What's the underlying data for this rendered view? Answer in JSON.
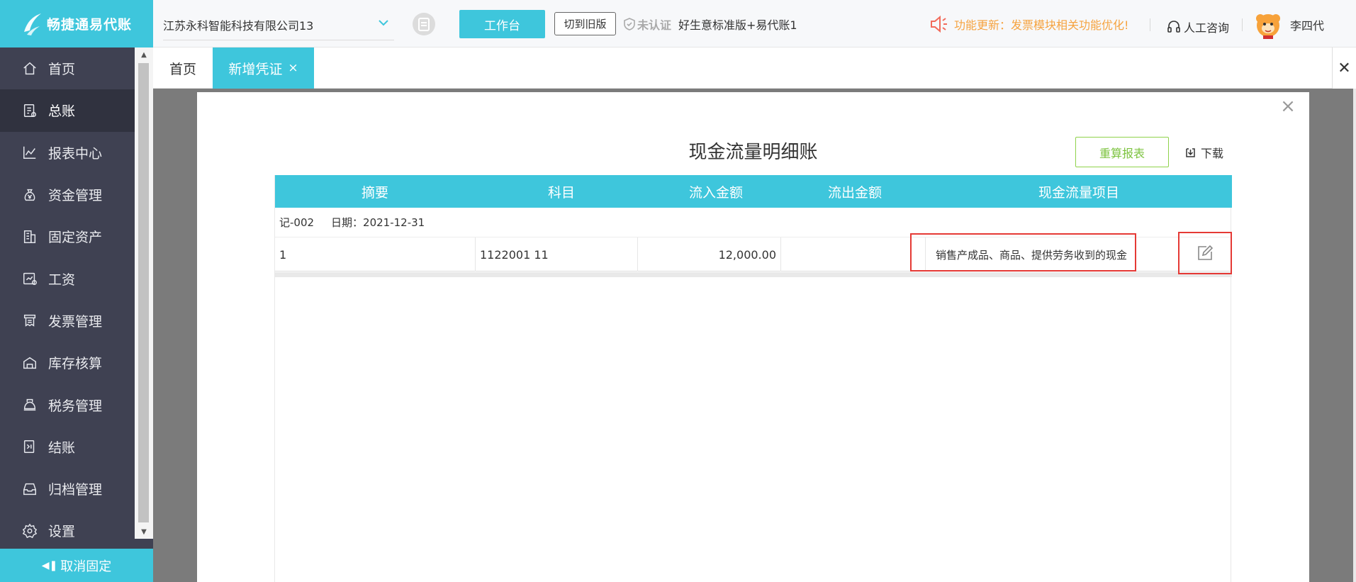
{
  "app": {
    "name": "畅捷通易代账"
  },
  "sidebar": {
    "items": [
      {
        "label": "首页",
        "icon": "home-icon"
      },
      {
        "label": "总账",
        "icon": "ledger-icon"
      },
      {
        "label": "报表中心",
        "icon": "chart-icon"
      },
      {
        "label": "资金管理",
        "icon": "money-bag-icon"
      },
      {
        "label": "固定资产",
        "icon": "building-icon"
      },
      {
        "label": "工资",
        "icon": "payroll-icon"
      },
      {
        "label": "发票管理",
        "icon": "invoice-icon"
      },
      {
        "label": "库存核算",
        "icon": "warehouse-icon"
      },
      {
        "label": "税务管理",
        "icon": "tax-icon"
      },
      {
        "label": "结账",
        "icon": "checkout-icon"
      },
      {
        "label": "归档管理",
        "icon": "archive-icon"
      },
      {
        "label": "设置",
        "icon": "gear-icon"
      }
    ],
    "active_index": 1,
    "unpin_label": "取消固定"
  },
  "topbar": {
    "company": "江苏永科智能科技有限公司13",
    "workbench_label": "工作台",
    "switch_old_label": "切到旧版",
    "cert_status": "未认证",
    "edition": "好生意标准版+易代账1",
    "notice": "功能更新：发票模块相关功能优化!",
    "consult_label": "人工咨询",
    "user_name": "李四代"
  },
  "tabs": [
    {
      "label": "首页"
    },
    {
      "label": "新增凭证",
      "close": "×"
    }
  ],
  "modal": {
    "title": "现金流量明细账",
    "recalc_label": "重算报表",
    "download_label": "下载",
    "close": "×",
    "table": {
      "headers": [
        "摘要",
        "科目",
        "流入金额",
        "流出金额",
        "现金流量项目"
      ],
      "group": {
        "voucher_no": "记-002",
        "date_label": "日期：2021-12-31"
      },
      "rows": [
        {
          "summary": "1",
          "account": "1122001 11",
          "inflow": "12,000.00",
          "outflow": "",
          "cashflow_item": "销售产成品、商品、提供劳务收到的现金"
        }
      ]
    }
  },
  "colors": {
    "accent": "#3ec6dc",
    "sidebar_bg": "#3f4152",
    "notice": "#f6a340",
    "highlight": "#e53935",
    "recalc_border": "#8fd24b"
  }
}
